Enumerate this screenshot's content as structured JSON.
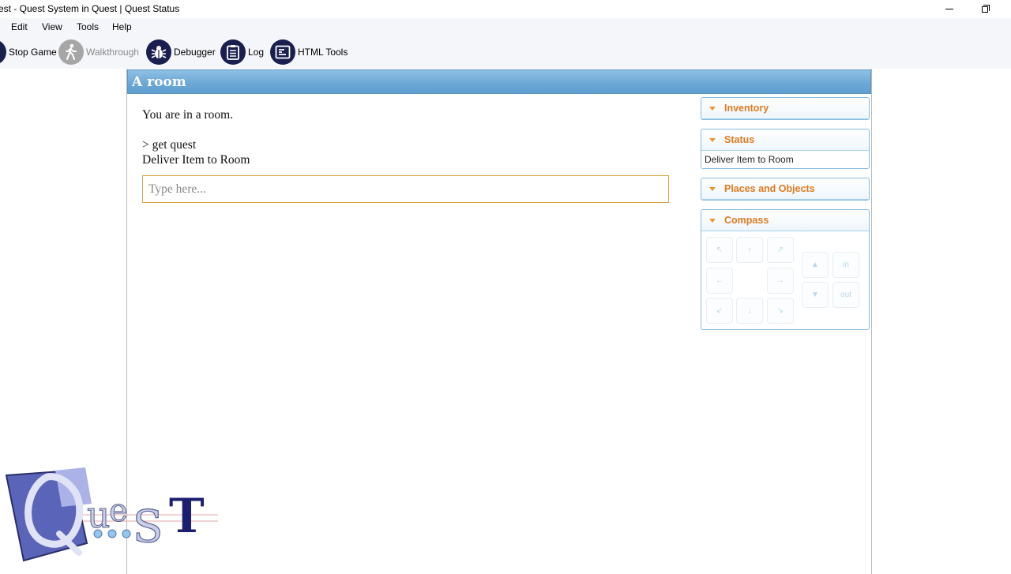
{
  "window": {
    "title": "est - Quest System in Quest | Quest Status"
  },
  "menu": [
    "Edit",
    "View",
    "Tools",
    "Help"
  ],
  "toolbar": {
    "stop_game": "Stop Game",
    "walkthrough": "Walkthrough",
    "debugger": "Debugger",
    "log": "Log",
    "html_tools": "HTML Tools"
  },
  "location": "A room",
  "output": {
    "line1": "You are in a room.",
    "line2": "> get quest",
    "line3": "Deliver Item to Room"
  },
  "command": {
    "placeholder": "Type here..."
  },
  "panels": {
    "inventory": "Inventory",
    "status": "Status",
    "status_value": "Deliver Item to Room",
    "places": "Places and Objects",
    "compass": "Compass"
  },
  "compass": {
    "nw": "↖",
    "n": "↑",
    "ne": "↗",
    "w": "←",
    "e": "→",
    "sw": "↙",
    "s": "↓",
    "se": "↘",
    "up": "▲",
    "down": "▼",
    "in": "in",
    "out": "out"
  },
  "logo": {
    "text": "QuesT"
  },
  "colors": {
    "location_bar": "#6aa7d6",
    "panel_header_text": "#e07b20",
    "toolbar_icon": "#1a1f4e",
    "command_border": "#d9a544"
  }
}
